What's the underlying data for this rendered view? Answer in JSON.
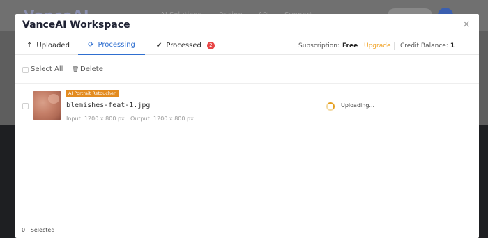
{
  "background": {
    "logo": "VanceAI",
    "nav": [
      "AI Solutions",
      "Pricing",
      "API",
      "Support"
    ]
  },
  "modal": {
    "title": "VanceAI Workspace",
    "close_label": "×"
  },
  "tabs": [
    {
      "label": "Uploaded",
      "icon": "↑"
    },
    {
      "label": "Processing",
      "icon": "⟳"
    },
    {
      "label": "Processed",
      "icon": "✔",
      "badge": "2"
    }
  ],
  "subscription": {
    "label": "Subscription:",
    "plan": "Free",
    "upgrade": "Upgrade",
    "credit_label": "Credit Balance:",
    "credit_value": "1"
  },
  "toolbar": {
    "select_all": "Select All",
    "delete": "Delete",
    "delete_icon": "🗑"
  },
  "items": [
    {
      "tag": "AI Portrait Retoucher",
      "filename": "blemishes-feat-1.jpg",
      "input": "Input:  1200 x 800 px",
      "output": "Output:  1200 x 800 px",
      "status": "Uploading..."
    }
  ],
  "footer": {
    "count": "0",
    "label": "Selected"
  },
  "colors": {
    "accent": "#2f6fd0",
    "upgrade": "#f0a020",
    "tag": "#e38b1f",
    "badge": "#e84545"
  }
}
